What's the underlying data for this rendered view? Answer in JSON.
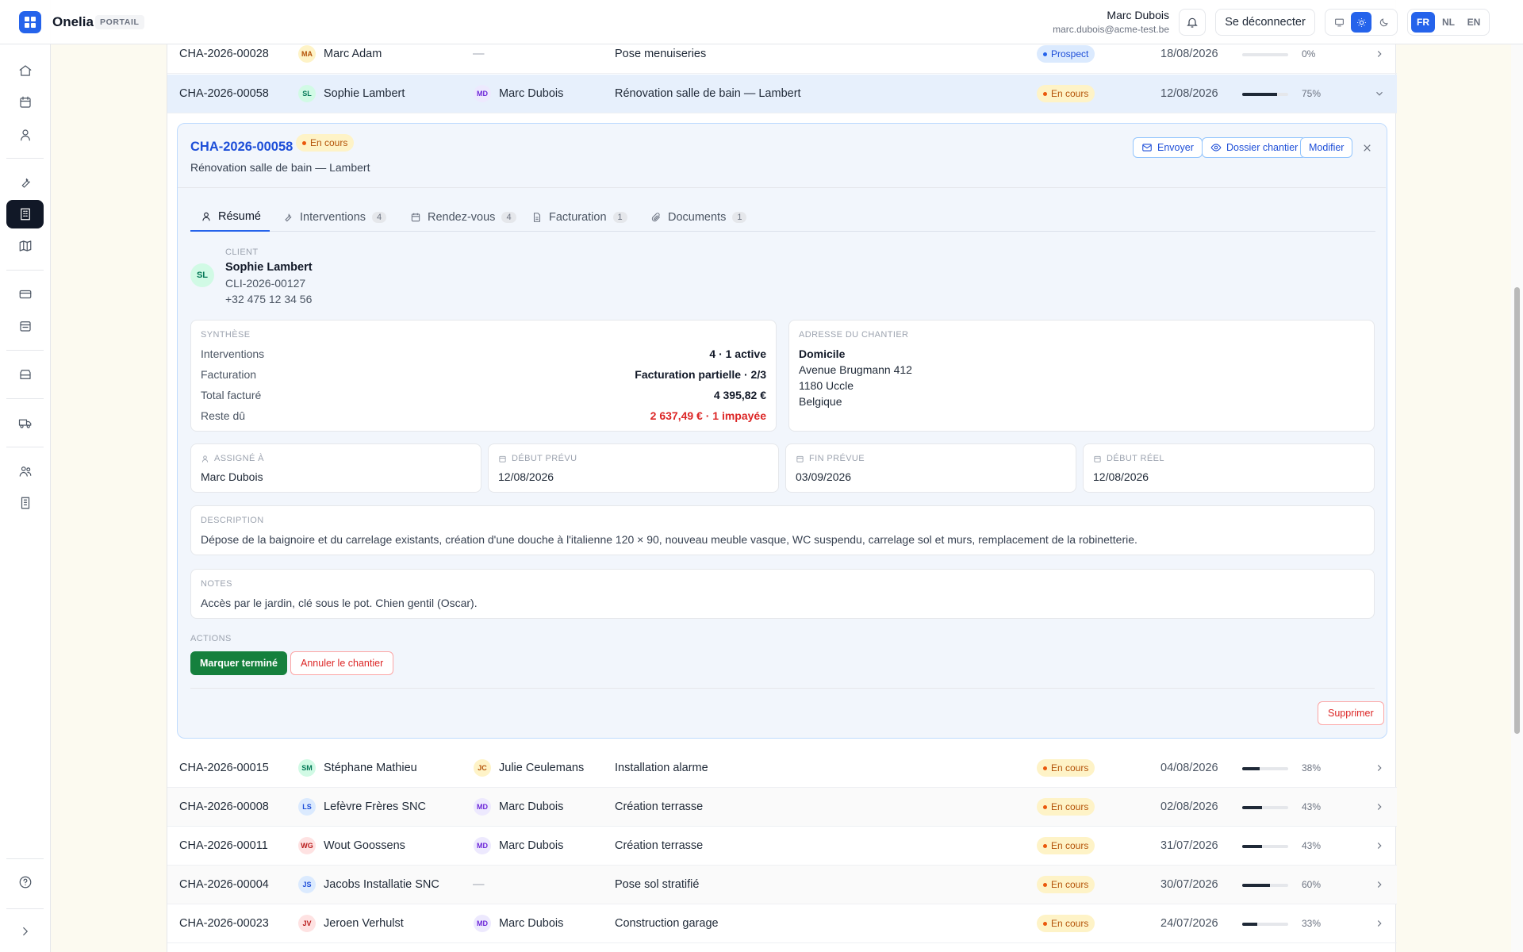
{
  "app": {
    "name": "Onelia",
    "badge": "PORTAIL"
  },
  "user": {
    "name": "Marc Dubois",
    "email": "marc.dubois@acme-test.be",
    "logout": "Se déconnecter"
  },
  "languages": [
    "FR",
    "NL",
    "EN"
  ],
  "active_language": "FR",
  "theme_options": [
    "desktop-icon",
    "sun-icon",
    "moon-icon"
  ],
  "active_theme": "sun-icon",
  "sidebar": {
    "active": "building-icon",
    "items": [
      "home-icon",
      "calendar-icon",
      "user-icon",
      "wrench-icon",
      "building-icon",
      "map-icon",
      "credit-card-icon",
      "calendar-check-icon",
      "archive-icon",
      "truck-icon",
      "users-icon",
      "office-icon",
      "help-icon",
      "expand-icon"
    ]
  },
  "rows_top": [
    {
      "id": "CHA-2026-00028",
      "client_initials": "MA",
      "client": "Marc Adam",
      "assignee_initials": "",
      "assignee": "—",
      "title": "Pose menuiseries",
      "status": "Prospect",
      "date": "18/08/2026",
      "progress": 0,
      "pct": "0%"
    },
    {
      "id": "CHA-2026-00058",
      "client_initials": "SL",
      "client": "Sophie Lambert",
      "assignee_initials": "MD",
      "assignee": "Marc Dubois",
      "title": "Rénovation salle de bain — Lambert",
      "status": "En cours",
      "date": "12/08/2026",
      "progress": 75,
      "pct": "75%"
    }
  ],
  "detail": {
    "id": "CHA-2026-00058",
    "status": "En cours",
    "subtitle": "Rénovation salle de bain — Lambert",
    "buttons": {
      "send": "Envoyer",
      "folder": "Dossier chantier",
      "edit": "Modifier"
    },
    "tabs": [
      {
        "label": "Résumé",
        "count": ""
      },
      {
        "label": "Interventions",
        "count": "4"
      },
      {
        "label": "Rendez-vous",
        "count": "4"
      },
      {
        "label": "Facturation",
        "count": "1"
      },
      {
        "label": "Documents",
        "count": "1"
      }
    ],
    "client": {
      "label": "CLIENT",
      "initials": "SL",
      "name": "Sophie Lambert",
      "ref": "CLI-2026-00127",
      "phone": "+32 475 12 34 56"
    },
    "synthese": {
      "label": "SYNTHÈSE",
      "rows": [
        {
          "k": "Interventions",
          "v": "4 · 1 active"
        },
        {
          "k": "Facturation",
          "v": "Facturation partielle · 2/3"
        },
        {
          "k": "Total facturé",
          "v": "4 395,82 €"
        },
        {
          "k": "Reste dû",
          "v": "2 637,49 € · 1 impayée"
        }
      ]
    },
    "address": {
      "label": "ADRESSE DU CHANTIER",
      "name": "Domicile",
      "street": "Avenue Brugmann 412",
      "city": "1180 Uccle",
      "country": "Belgique"
    },
    "fields": [
      {
        "label": "ASSIGNÉ À",
        "value": "Marc Dubois"
      },
      {
        "label": "DÉBUT PRÉVU",
        "value": "12/08/2026"
      },
      {
        "label": "FIN PRÉVUE",
        "value": "03/09/2026"
      },
      {
        "label": "DÉBUT RÉEL",
        "value": "12/08/2026"
      }
    ],
    "description": {
      "label": "DESCRIPTION",
      "text": "Dépose de la baignoire et du carrelage existants, création d'une douche à l'italienne 120 × 90, nouveau meuble vasque, WC suspendu, carrelage sol et murs, remplacement de la robinetterie."
    },
    "notes": {
      "label": "NOTES",
      "text": "Accès par le jardin, clé sous le pot. Chien gentil (Oscar)."
    },
    "actions": {
      "label": "ACTIONS",
      "complete": "Marquer terminé",
      "cancel": "Annuler le chantier"
    },
    "delete": "Supprimer"
  },
  "rows_bottom": [
    {
      "id": "CHA-2026-00015",
      "client_initials": "SM",
      "client": "Stéphane Mathieu",
      "assignee_initials": "JC",
      "assignee": "Julie Ceulemans",
      "title": "Installation alarme",
      "status": "En cours",
      "date": "04/08/2026",
      "progress": 38,
      "pct": "38%"
    },
    {
      "id": "CHA-2026-00008",
      "client_initials": "LS",
      "client": "Lefèvre Frères SNC",
      "assignee_initials": "MD",
      "assignee": "Marc Dubois",
      "title": "Création terrasse",
      "status": "En cours",
      "date": "02/08/2026",
      "progress": 43,
      "pct": "43%"
    },
    {
      "id": "CHA-2026-00011",
      "client_initials": "WG",
      "client": "Wout Goossens",
      "assignee_initials": "MD",
      "assignee": "Marc Dubois",
      "title": "Création terrasse",
      "status": "En cours",
      "date": "31/07/2026",
      "progress": 43,
      "pct": "43%"
    },
    {
      "id": "CHA-2026-00004",
      "client_initials": "JS",
      "client": "Jacobs Installatie SNC",
      "assignee_initials": "",
      "assignee": "—",
      "title": "Pose sol stratifié",
      "status": "En cours",
      "date": "30/07/2026",
      "progress": 60,
      "pct": "60%"
    },
    {
      "id": "CHA-2026-00023",
      "client_initials": "JV",
      "client": "Jeroen Verhulst",
      "assignee_initials": "MD",
      "assignee": "Marc Dubois",
      "title": "Construction garage",
      "status": "En cours",
      "date": "24/07/2026",
      "progress": 33,
      "pct": "33%"
    }
  ]
}
